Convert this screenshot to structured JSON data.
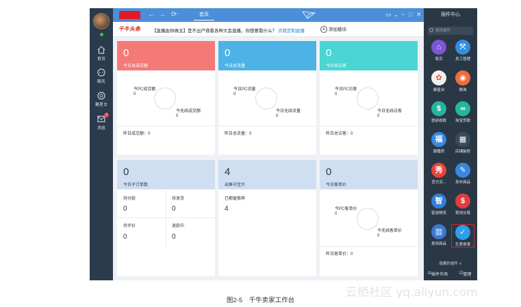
{
  "nav": [
    {
      "label": "首页",
      "icon": "home-icon"
    },
    {
      "label": "聊天",
      "icon": "chat-icon"
    },
    {
      "label": "聚星台",
      "icon": "star-cluster-icon"
    },
    {
      "label": "消息",
      "icon": "message-icon",
      "badge": "3"
    }
  ],
  "topbar": {
    "tab": "首页",
    "nav_back": "←",
    "nav_forward": "→",
    "refresh": "⟳",
    "chat_btn": "▭",
    "menu_btn": "⌄",
    "min_btn": "−",
    "max_btn": "□",
    "close_btn": "✕"
  },
  "notice": {
    "logo": "千牛头条",
    "text": "【直播由你做主】是不出户观看各种大会直播，你想要看什么？",
    "link": "点我定制直播",
    "add_module": "添加模块",
    "add_symbol": "+"
  },
  "cards": {
    "transactions": {
      "value": "0",
      "caption": "今日总成交额",
      "pc_label": "今PC成交额",
      "pc_value": "0",
      "wireless_label": "今无线成交额",
      "wireless_value": "0",
      "footer": "昨日成交额：0",
      "color": "#f47a78"
    },
    "traffic": {
      "value": "0",
      "caption": "今日总流量",
      "pc_label": "今日PC流量",
      "pc_value": "0",
      "wireless_label": "今日无线流量",
      "wireless_value": "0",
      "footer": "昨日总流量：0",
      "color": "#4db3e6"
    },
    "visitors": {
      "value": "0",
      "caption": "今日总访客",
      "pc_label": "今日PC访客",
      "pc_value": "0",
      "wireless_label": "今日无线访客",
      "wireless_value": "0",
      "footer": "昨日总访客：0",
      "color": "#4ad5d3"
    },
    "orders": {
      "value": "0",
      "caption": "今日子订单数",
      "items": [
        {
          "label": "待付款",
          "value": "0"
        },
        {
          "label": "待发货",
          "value": "0"
        },
        {
          "label": "待评价",
          "value": "0"
        },
        {
          "label": "退款中",
          "value": "0"
        }
      ],
      "color": "#cfdef0"
    },
    "selling": {
      "value": "4",
      "caption": "出售中宝贝",
      "sub_label": "已橱窗推荐",
      "sub_value": "4",
      "color": "#cfdef0"
    },
    "unit_price": {
      "value": "0",
      "caption": "今日客单价",
      "pc_label": "今PC客单价",
      "pc_value": "0",
      "wireless_label": "今无线客单价",
      "wireless_value": "0",
      "footer": "昨日客单价：0",
      "color": "#cfdef0"
    }
  },
  "plugin_center": {
    "title": "插件中心",
    "search_placeholder": "查找插件",
    "plugins": [
      {
        "label": "首页",
        "icon": "home-icon",
        "color": "#7c56d8",
        "glyph": "⌂"
      },
      {
        "label": "员工管理",
        "icon": "employee-icon",
        "color": "#2f8fe0",
        "glyph": "⤧"
      },
      {
        "label": "聚星台",
        "icon": "star-icon",
        "color": "#f0f0f0",
        "glyph": "✿"
      },
      {
        "label": "微淘",
        "icon": "weitao-icon",
        "color": "#f26b3a",
        "glyph": "◉"
      },
      {
        "label": "提前收款",
        "icon": "early-payment-icon",
        "color": "#25b59f",
        "glyph": "$"
      },
      {
        "label": "淘宝贷款",
        "icon": "loan-icon",
        "color": "#25b59f",
        "glyph": "∞"
      },
      {
        "label": "御膳房",
        "icon": "kitchen-icon",
        "color": "#3a86e0",
        "glyph": "福"
      },
      {
        "label": "店铺装修",
        "icon": "decoration-icon",
        "color": "#3b4b5c",
        "glyph": "▦"
      },
      {
        "label": "官方买...",
        "icon": "official-buy-icon",
        "color": "#e8433a",
        "glyph": "秀"
      },
      {
        "label": "发布商品",
        "icon": "publish-icon",
        "color": "#3a86e0",
        "glyph": "✎"
      },
      {
        "label": "智选物流",
        "icon": "logistics-icon",
        "color": "#2f7fd8",
        "glyph": "智"
      },
      {
        "label": "爱用交易",
        "icon": "trade-icon",
        "color": "#e23c3c",
        "glyph": "$"
      },
      {
        "label": "爱用商品",
        "icon": "goods-icon",
        "color": "#3a7bd5",
        "glyph": "▥"
      },
      {
        "label": "生意参谋",
        "icon": "business-advisor-icon",
        "color": "#2f9de8",
        "glyph": "✓"
      }
    ],
    "hidden_plugins": "隐藏的插件 ∧",
    "market": "插件市场",
    "manage": "管理"
  },
  "watermark": "云栖社区 yq.aliyun.com",
  "caption": "图2-5　千牛卖家工作台"
}
